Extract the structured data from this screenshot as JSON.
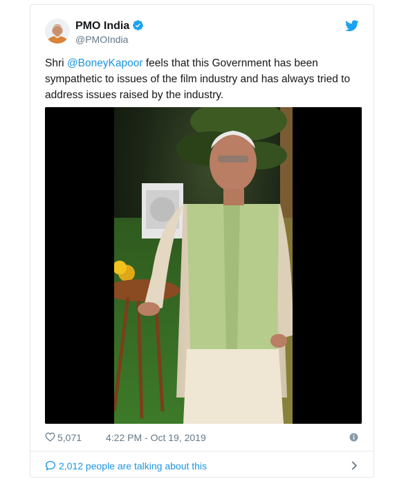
{
  "tweet": {
    "display_name": "PMO India",
    "handle": "@PMOIndia",
    "text_prefix": "Shri ",
    "mention": "@BoneyKapoor",
    "text_suffix": " feels that this Government has been sympathetic to issues of the film industry and has always tried to address issues raised by the industry.",
    "likes": "5,071",
    "timestamp": "4:22 PM - Oct 19, 2019",
    "talking": "2,012 people are talking about this"
  },
  "icons": {
    "verified": "verified-badge-icon",
    "brand": "twitter-bird-icon",
    "like": "heart-icon",
    "info": "info-icon",
    "reply": "speech-bubble-icon",
    "chevron": "chevron-right-icon"
  },
  "colors": {
    "link_blue": "#1b95e0",
    "twitter_blue": "#1da1f2",
    "muted_text": "#657786",
    "border": "#e1e8ed"
  }
}
